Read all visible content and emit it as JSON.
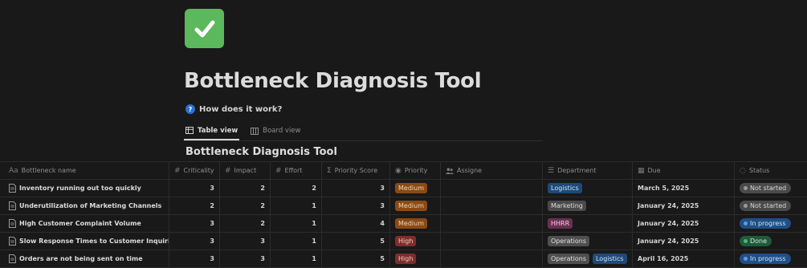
{
  "page": {
    "icon": "check-mark-icon",
    "title": "Bottleneck Diagnosis Tool",
    "help_link": "How does it work?"
  },
  "views": [
    {
      "label": "Table view",
      "icon": "table-icon",
      "active": true
    },
    {
      "label": "Board view",
      "icon": "board-icon",
      "active": false
    }
  ],
  "database": {
    "title": "Bottleneck Diagnosis Tool",
    "columns": [
      {
        "label": "Bottleneck name",
        "icon": "Aa"
      },
      {
        "label": "Criticality",
        "icon": "#"
      },
      {
        "label": "Impact",
        "icon": "#"
      },
      {
        "label": "Effort",
        "icon": "#"
      },
      {
        "label": "Priority Score",
        "icon": "Σ"
      },
      {
        "label": "Priority",
        "icon": "◉"
      },
      {
        "label": "Assigne",
        "icon": "people"
      },
      {
        "label": "Department",
        "icon": "☰"
      },
      {
        "label": "Due",
        "icon": "▦"
      },
      {
        "label": "Status",
        "icon": "◌"
      }
    ],
    "rows": [
      {
        "name": "Inventory running out too quickly",
        "criticality": "3",
        "impact": "2",
        "effort": "2",
        "priority_score": "3",
        "priority": "Medium",
        "assignee": "",
        "departments": [
          "Logistics"
        ],
        "due": "March 5, 2025",
        "status": "Not started"
      },
      {
        "name": "Underutilization of Marketing Channels",
        "criticality": "2",
        "impact": "2",
        "effort": "1",
        "priority_score": "3",
        "priority": "Medium",
        "assignee": "",
        "departments": [
          "Marketing"
        ],
        "due": "January 24, 2025",
        "status": "Not started"
      },
      {
        "name": "High Customer Complaint Volume",
        "criticality": "3",
        "impact": "2",
        "effort": "1",
        "priority_score": "4",
        "priority": "Medium",
        "assignee": "",
        "departments": [
          "HHRR"
        ],
        "due": "January 24, 2025",
        "status": "In progress"
      },
      {
        "name": "Slow Response Times to Customer Inquiries",
        "criticality": "3",
        "impact": "3",
        "effort": "1",
        "priority_score": "5",
        "priority": "High",
        "assignee": "",
        "departments": [
          "Operations"
        ],
        "due": "January 24, 2025",
        "status": "Done"
      },
      {
        "name": "Orders are not being sent on time",
        "criticality": "3",
        "impact": "3",
        "effort": "1",
        "priority_score": "5",
        "priority": "High",
        "assignee": "",
        "departments": [
          "Operations",
          "Logistics"
        ],
        "due": "April 16, 2025",
        "status": "In progress"
      }
    ]
  },
  "colors": {
    "priority": {
      "Medium": {
        "bg": "#8a4a14",
        "fg": "#f0d2b4"
      },
      "High": {
        "bg": "#7c2f2a",
        "fg": "#f2c7c2"
      }
    },
    "department": {
      "Logistics": {
        "bg": "#1e4a78",
        "fg": "#cfe2f7"
      },
      "Marketing": {
        "bg": "#4a4a4a",
        "fg": "#dcdcdc"
      },
      "HHRR": {
        "bg": "#6b2f52",
        "fg": "#f0cfe2"
      },
      "Operations": {
        "bg": "#4f4f4f",
        "fg": "#e0e0e0"
      }
    },
    "status": {
      "Not started": {
        "bg": "#4a4a4a",
        "fg": "#d8d8d8",
        "dot": "#9a9a9a"
      },
      "In progress": {
        "bg": "#1f4f86",
        "fg": "#d2e4f8",
        "dot": "#5a9be6"
      },
      "Done": {
        "bg": "#1f5a3a",
        "fg": "#cdebd8",
        "dot": "#4fb27a"
      }
    }
  }
}
